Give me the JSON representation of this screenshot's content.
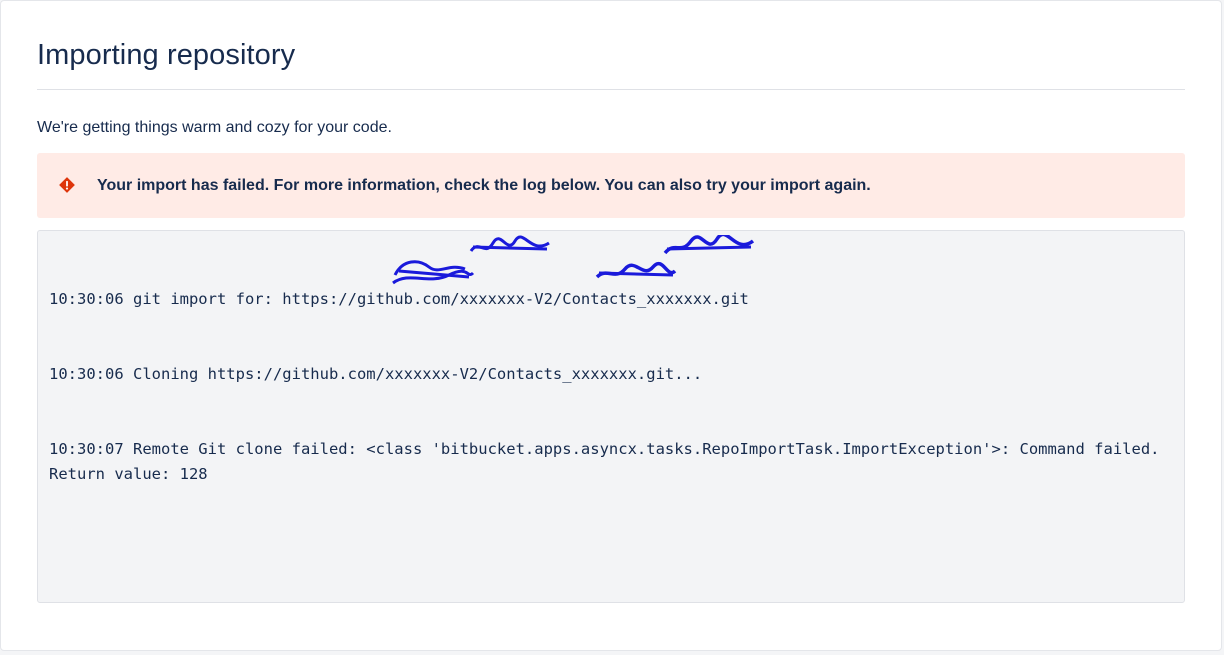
{
  "page": {
    "title": "Importing repository",
    "subtitle": "We're getting things warm and cozy for your code."
  },
  "alert": {
    "icon": "error-icon",
    "message": "Your import has failed. For more information, check the log below. You can also try your import again.",
    "color": "#de350b",
    "background": "#ffebe6"
  },
  "log": {
    "lines": [
      "10:30:06 git import for: https://github.com/xxxxxxx-V2/Contacts_xxxxxxx.git",
      "10:30:06 Cloning https://github.com/xxxxxxx-V2/Contacts_xxxxxxx.git...",
      "10:30:07 Remote Git clone failed: <class 'bitbucket.apps.asyncx.tasks.RepoImportTask.ImportException'>: Command failed. Return value: 128"
    ]
  }
}
